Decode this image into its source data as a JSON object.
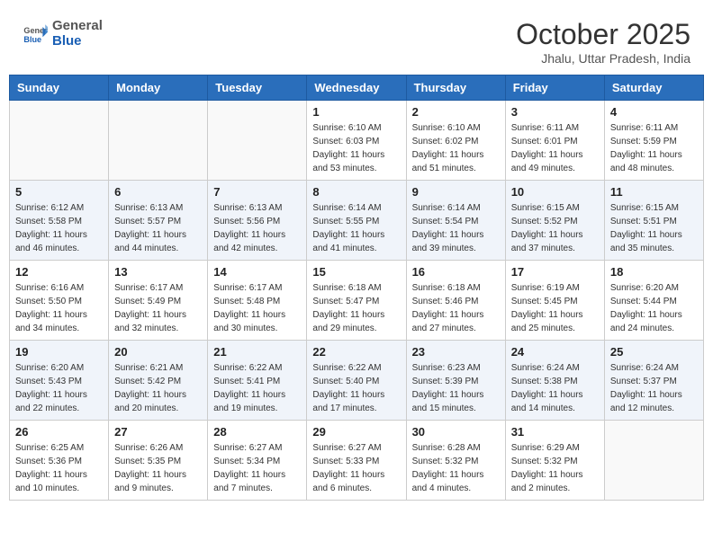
{
  "header": {
    "logo_general": "General",
    "logo_blue": "Blue",
    "month": "October 2025",
    "location": "Jhalu, Uttar Pradesh, India"
  },
  "weekdays": [
    "Sunday",
    "Monday",
    "Tuesday",
    "Wednesday",
    "Thursday",
    "Friday",
    "Saturday"
  ],
  "weeks": [
    [
      {
        "day": "",
        "info": ""
      },
      {
        "day": "",
        "info": ""
      },
      {
        "day": "",
        "info": ""
      },
      {
        "day": "1",
        "info": "Sunrise: 6:10 AM\nSunset: 6:03 PM\nDaylight: 11 hours\nand 53 minutes."
      },
      {
        "day": "2",
        "info": "Sunrise: 6:10 AM\nSunset: 6:02 PM\nDaylight: 11 hours\nand 51 minutes."
      },
      {
        "day": "3",
        "info": "Sunrise: 6:11 AM\nSunset: 6:01 PM\nDaylight: 11 hours\nand 49 minutes."
      },
      {
        "day": "4",
        "info": "Sunrise: 6:11 AM\nSunset: 5:59 PM\nDaylight: 11 hours\nand 48 minutes."
      }
    ],
    [
      {
        "day": "5",
        "info": "Sunrise: 6:12 AM\nSunset: 5:58 PM\nDaylight: 11 hours\nand 46 minutes."
      },
      {
        "day": "6",
        "info": "Sunrise: 6:13 AM\nSunset: 5:57 PM\nDaylight: 11 hours\nand 44 minutes."
      },
      {
        "day": "7",
        "info": "Sunrise: 6:13 AM\nSunset: 5:56 PM\nDaylight: 11 hours\nand 42 minutes."
      },
      {
        "day": "8",
        "info": "Sunrise: 6:14 AM\nSunset: 5:55 PM\nDaylight: 11 hours\nand 41 minutes."
      },
      {
        "day": "9",
        "info": "Sunrise: 6:14 AM\nSunset: 5:54 PM\nDaylight: 11 hours\nand 39 minutes."
      },
      {
        "day": "10",
        "info": "Sunrise: 6:15 AM\nSunset: 5:52 PM\nDaylight: 11 hours\nand 37 minutes."
      },
      {
        "day": "11",
        "info": "Sunrise: 6:15 AM\nSunset: 5:51 PM\nDaylight: 11 hours\nand 35 minutes."
      }
    ],
    [
      {
        "day": "12",
        "info": "Sunrise: 6:16 AM\nSunset: 5:50 PM\nDaylight: 11 hours\nand 34 minutes."
      },
      {
        "day": "13",
        "info": "Sunrise: 6:17 AM\nSunset: 5:49 PM\nDaylight: 11 hours\nand 32 minutes."
      },
      {
        "day": "14",
        "info": "Sunrise: 6:17 AM\nSunset: 5:48 PM\nDaylight: 11 hours\nand 30 minutes."
      },
      {
        "day": "15",
        "info": "Sunrise: 6:18 AM\nSunset: 5:47 PM\nDaylight: 11 hours\nand 29 minutes."
      },
      {
        "day": "16",
        "info": "Sunrise: 6:18 AM\nSunset: 5:46 PM\nDaylight: 11 hours\nand 27 minutes."
      },
      {
        "day": "17",
        "info": "Sunrise: 6:19 AM\nSunset: 5:45 PM\nDaylight: 11 hours\nand 25 minutes."
      },
      {
        "day": "18",
        "info": "Sunrise: 6:20 AM\nSunset: 5:44 PM\nDaylight: 11 hours\nand 24 minutes."
      }
    ],
    [
      {
        "day": "19",
        "info": "Sunrise: 6:20 AM\nSunset: 5:43 PM\nDaylight: 11 hours\nand 22 minutes."
      },
      {
        "day": "20",
        "info": "Sunrise: 6:21 AM\nSunset: 5:42 PM\nDaylight: 11 hours\nand 20 minutes."
      },
      {
        "day": "21",
        "info": "Sunrise: 6:22 AM\nSunset: 5:41 PM\nDaylight: 11 hours\nand 19 minutes."
      },
      {
        "day": "22",
        "info": "Sunrise: 6:22 AM\nSunset: 5:40 PM\nDaylight: 11 hours\nand 17 minutes."
      },
      {
        "day": "23",
        "info": "Sunrise: 6:23 AM\nSunset: 5:39 PM\nDaylight: 11 hours\nand 15 minutes."
      },
      {
        "day": "24",
        "info": "Sunrise: 6:24 AM\nSunset: 5:38 PM\nDaylight: 11 hours\nand 14 minutes."
      },
      {
        "day": "25",
        "info": "Sunrise: 6:24 AM\nSunset: 5:37 PM\nDaylight: 11 hours\nand 12 minutes."
      }
    ],
    [
      {
        "day": "26",
        "info": "Sunrise: 6:25 AM\nSunset: 5:36 PM\nDaylight: 11 hours\nand 10 minutes."
      },
      {
        "day": "27",
        "info": "Sunrise: 6:26 AM\nSunset: 5:35 PM\nDaylight: 11 hours\nand 9 minutes."
      },
      {
        "day": "28",
        "info": "Sunrise: 6:27 AM\nSunset: 5:34 PM\nDaylight: 11 hours\nand 7 minutes."
      },
      {
        "day": "29",
        "info": "Sunrise: 6:27 AM\nSunset: 5:33 PM\nDaylight: 11 hours\nand 6 minutes."
      },
      {
        "day": "30",
        "info": "Sunrise: 6:28 AM\nSunset: 5:32 PM\nDaylight: 11 hours\nand 4 minutes."
      },
      {
        "day": "31",
        "info": "Sunrise: 6:29 AM\nSunset: 5:32 PM\nDaylight: 11 hours\nand 2 minutes."
      },
      {
        "day": "",
        "info": ""
      }
    ]
  ]
}
